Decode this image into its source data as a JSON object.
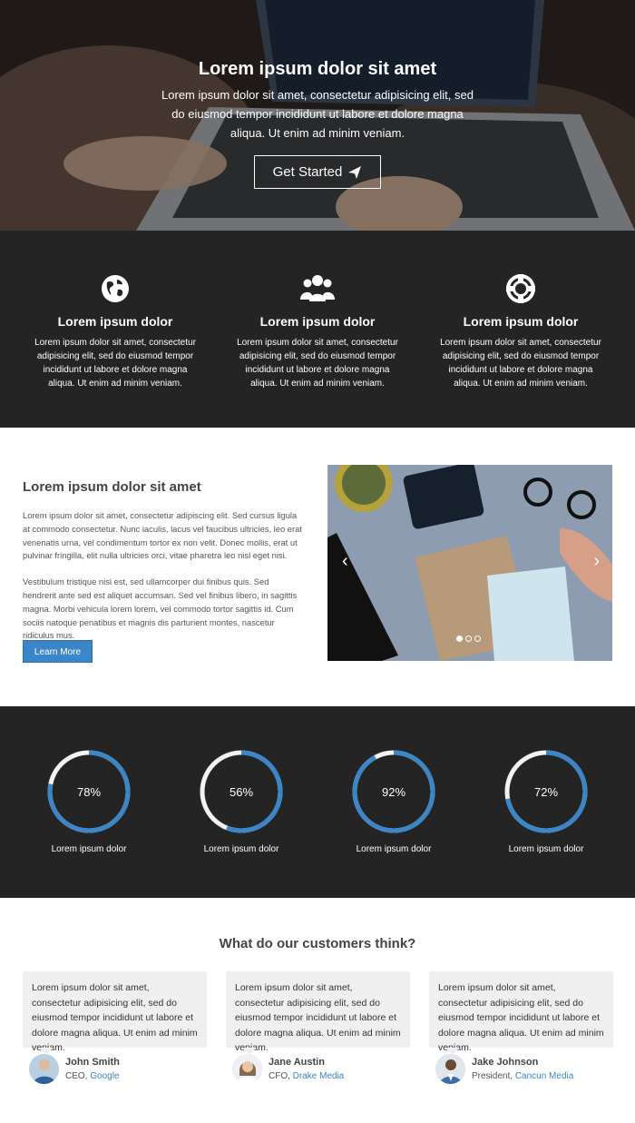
{
  "hero": {
    "title": "Lorem ipsum dolor sit amet",
    "text": "Lorem ipsum dolor sit amet, consectetur adipisicing elit, sed do eiusmod tempor incididunt ut labore et dolore magna aliqua. Ut enim ad minim veniam.",
    "button_label": "Get Started",
    "button_icon": "paper-plane-icon"
  },
  "features": [
    {
      "icon": "globe-icon",
      "title": "Lorem ipsum dolor",
      "text": "Lorem ipsum dolor sit amet, consectetur adipisicing elit, sed do eiusmod tempor incididunt ut labore et dolore magna aliqua. Ut enim ad minim veniam."
    },
    {
      "icon": "users-icon",
      "title": "Lorem ipsum dolor",
      "text": "Lorem ipsum dolor sit amet, consectetur adipisicing elit, sed do eiusmod tempor incididunt ut labore et dolore magna aliqua. Ut enim ad minim veniam."
    },
    {
      "icon": "life-ring-icon",
      "title": "Lorem ipsum dolor",
      "text": "Lorem ipsum dolor sit amet, consectetur adipisicing elit, sed do eiusmod tempor incididunt ut labore et dolore magna aliqua. Ut enim ad minim veniam."
    }
  ],
  "about": {
    "title": "Lorem ipsum dolor sit amet",
    "paragraph1": "Lorem ipsum dolor sit amet, consectetur adipiscing elit. Sed cursus ligula at commodo consectetur. Nunc iaculis, lacus vel faucibus ultricies, leo erat venenatis urna, vel condimentum tortor ex non velit. Donec mollis, erat ut pulvinar fringilla, elit nulla ultricies orci, vitae pharetra leo nisl eget nisi.",
    "paragraph2": "Vestibulum tristique nisl est, sed ullamcorper dui finibus quis. Sed hendrerit ante sed est aliquet accumsan. Sed vel finibus libero, in sagittis magna. Morbi vehicula lorem lorem, vel commodo tortor sagittis id. Cum sociis natoque penatibus et magnis dis parturient montes, nascetur ridiculus mus.",
    "button_label": "Learn More"
  },
  "slider": {
    "prev_icon": "chevron-left-icon",
    "next_icon": "chevron-right-icon",
    "slide_count": 3,
    "active_slide": 1
  },
  "stats": [
    {
      "value": 78,
      "label_value": "78%",
      "label": "Lorem ipsum dolor"
    },
    {
      "value": 56,
      "label_value": "56%",
      "label": "Lorem ipsum dolor"
    },
    {
      "value": 92,
      "label_value": "92%",
      "label": "Lorem ipsum dolor"
    },
    {
      "value": 72,
      "label_value": "72%",
      "label": "Lorem ipsum dolor"
    }
  ],
  "testimonials": {
    "heading": "What do our customers think?",
    "items": [
      {
        "quote": "Lorem ipsum dolor sit amet, consectetur adipisicing elit, sed do eiusmod tempor incididunt ut labore et dolore magna aliqua. Ut enim ad minim veniam.",
        "name": "John Smith",
        "role": "CEO,",
        "company": "Google"
      },
      {
        "quote": "Lorem ipsum dolor sit amet, consectetur adipisicing elit, sed do eiusmod tempor incididunt ut labore et dolore magna aliqua. Ut enim ad minim veniam.",
        "name": "Jane Austin",
        "role": "CFO,",
        "company": "Drake Media"
      },
      {
        "quote": "Lorem ipsum dolor sit amet, consectetur adipisicing elit, sed do eiusmod tempor incididunt ut labore et dolore magna aliqua. Ut enim ad minim veniam.",
        "name": "Jake Johnson",
        "role": "President,",
        "company": "Cancun Media"
      }
    ]
  },
  "colors": {
    "dark_bg": "#242424",
    "accent_blue": "#3a86c8",
    "ring_track": "#f2f2f2",
    "quote_bg": "#efefef"
  }
}
